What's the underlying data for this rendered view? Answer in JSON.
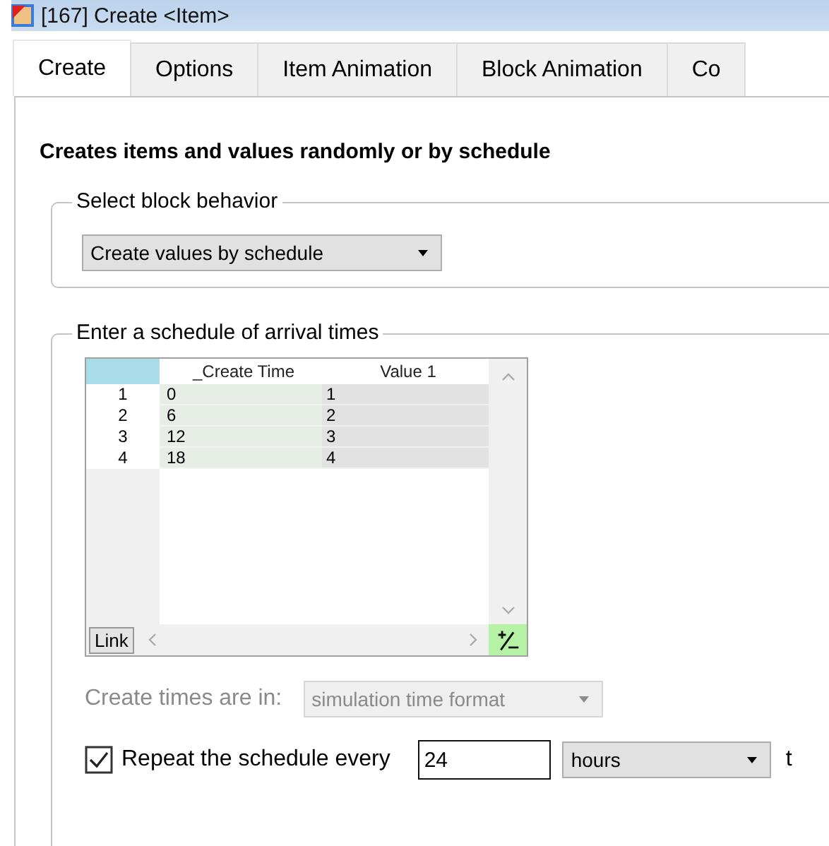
{
  "window": {
    "title": "[167] Create <Item>"
  },
  "tabs": [
    {
      "label": "Create",
      "selected": true
    },
    {
      "label": "Options",
      "selected": false
    },
    {
      "label": "Item Animation",
      "selected": false
    },
    {
      "label": "Block Animation",
      "selected": false
    },
    {
      "label": "Co",
      "selected": false
    }
  ],
  "heading": "Creates items and values randomly or by schedule",
  "behavior_group": {
    "title": "Select block behavior",
    "dropdown": {
      "value": "Create values by schedule"
    }
  },
  "schedule_group": {
    "title": "Enter a schedule of arrival times",
    "table": {
      "columns": [
        "_Create Time",
        "Value 1"
      ],
      "rows": [
        {
          "number": "1",
          "cells": [
            "0",
            "1"
          ]
        },
        {
          "number": "2",
          "cells": [
            "6",
            "2"
          ]
        },
        {
          "number": "3",
          "cells": [
            "12",
            "3"
          ]
        },
        {
          "number": "4",
          "cells": [
            "18",
            "4"
          ]
        }
      ],
      "link_button": "Link"
    },
    "times_format": {
      "label": "Create times are in:",
      "dropdown": {
        "value": "simulation time format",
        "disabled": true
      }
    },
    "repeat": {
      "checked": true,
      "label": "Repeat the schedule every",
      "value": "24",
      "unit": "hours",
      "trailing": "t"
    }
  }
}
